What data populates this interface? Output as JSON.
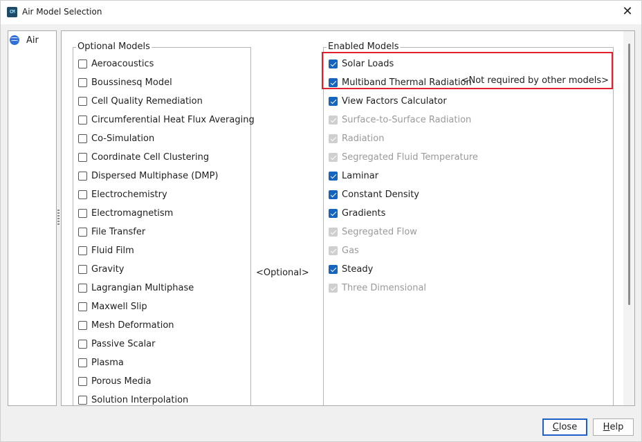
{
  "window": {
    "title": "Air Model Selection",
    "app_icon_text": "CM",
    "close_glyph": "✕"
  },
  "tree": {
    "items": [
      {
        "label": "Air",
        "icon": "air-continuum-icon"
      }
    ]
  },
  "optional": {
    "legend": "Optional Models",
    "items": [
      "Aeroacoustics",
      "Boussinesq Model",
      "Cell Quality Remediation",
      "Circumferential Heat Flux Averaging",
      "Co-Simulation",
      "Coordinate Cell Clustering",
      "Dispersed Multiphase (DMP)",
      "Electrochemistry",
      "Electromagnetism",
      "File Transfer",
      "Fluid Film",
      "Gravity",
      "Lagrangian Multiphase",
      "Maxwell Slip",
      "Mesh Deformation",
      "Passive Scalar",
      "Plasma",
      "Porous Media",
      "Solution Interpolation"
    ]
  },
  "middle": {
    "label": "<Optional>"
  },
  "enabled": {
    "legend": "Enabled Models",
    "note": "<Not required by other models>",
    "items": [
      {
        "label": "Solar Loads",
        "state": "checked"
      },
      {
        "label": "Multiband Thermal Radiation",
        "state": "checked"
      },
      {
        "label": "View Factors Calculator",
        "state": "checked"
      },
      {
        "label": "Surface-to-Surface Radiation",
        "state": "disabled"
      },
      {
        "label": "Radiation",
        "state": "disabled"
      },
      {
        "label": "Segregated Fluid Temperature",
        "state": "disabled"
      },
      {
        "label": "Laminar",
        "state": "checked"
      },
      {
        "label": "Constant Density",
        "state": "checked"
      },
      {
        "label": "Gradients",
        "state": "checked"
      },
      {
        "label": "Segregated Flow",
        "state": "disabled"
      },
      {
        "label": "Gas",
        "state": "disabled"
      },
      {
        "label": "Steady",
        "state": "checked"
      },
      {
        "label": "Three Dimensional",
        "state": "disabled"
      }
    ]
  },
  "buttons": {
    "close_first": "C",
    "close_rest": "lose",
    "help_first": "H",
    "help_rest": "elp"
  },
  "colors": {
    "accent": "#1565c0",
    "highlight": "#e0202d",
    "disabled": "#9a9a9a"
  }
}
